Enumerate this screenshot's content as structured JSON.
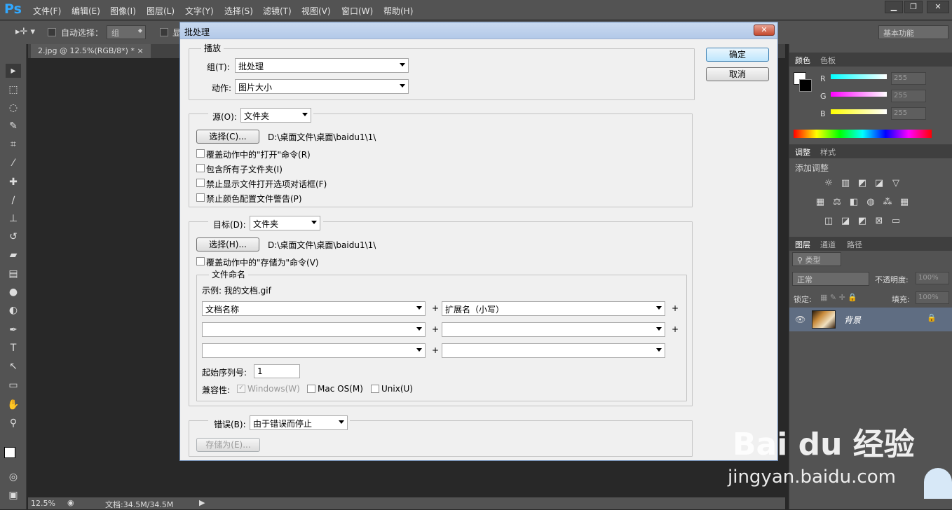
{
  "app": {
    "logo": "Ps"
  },
  "menu": [
    "文件(F)",
    "编辑(E)",
    "图像(I)",
    "图层(L)",
    "文字(Y)",
    "选择(S)",
    "滤镜(T)",
    "视图(V)",
    "窗口(W)",
    "帮助(H)"
  ],
  "options_bar": {
    "auto_select_label": "自动选择：",
    "auto_select_value": "组",
    "show_label": "显",
    "workspace": "基本功能"
  },
  "document": {
    "tab": "2.jpg @ 12.5%(RGB/8*) *",
    "close": "×"
  },
  "status": {
    "zoom": "12.5%",
    "doc": "文档:34.5M/34.5M"
  },
  "panels": {
    "color": {
      "tabs": [
        "颜色",
        "色板"
      ],
      "r": "R",
      "g": "G",
      "b": "B",
      "r_val": "255",
      "g_val": "255",
      "b_val": "255"
    },
    "adjust": {
      "tabs": [
        "调整",
        "样式"
      ],
      "title": "添加调整"
    },
    "layers": {
      "tabs": [
        "图层",
        "通道",
        "路径"
      ],
      "kind": "类型",
      "blend": "正常",
      "opacity_label": "不透明度:",
      "opacity": "100%",
      "lock_label": "锁定:",
      "fill_label": "填充:",
      "fill": "100%",
      "layer_name": "背景"
    }
  },
  "dialog": {
    "title": "批处理",
    "close": "✕",
    "ok": "确定",
    "cancel": "取消",
    "play": {
      "title": "播放",
      "group_label": "组(T):",
      "group_value": "批处理",
      "action_label": "动作:",
      "action_value": "图片大小"
    },
    "source": {
      "label": "源(O):",
      "value": "文件夹",
      "choose": "选择(C)...",
      "path": "D:\\桌面文件\\桌面\\baidu1\\1\\",
      "options": [
        "覆盖动作中的\"打开\"命令(R)",
        "包含所有子文件夹(I)",
        "禁止显示文件打开选项对话框(F)",
        "禁止颜色配置文件警告(P)"
      ]
    },
    "target": {
      "label": "目标(D):",
      "value": "文件夹",
      "choose": "选择(H)...",
      "path": "D:\\桌面文件\\桌面\\baidu1\\1\\",
      "override": "覆盖动作中的\"存储为\"命令(V)"
    },
    "naming": {
      "title": "文件命名",
      "example": "示例: 我的文档.gif",
      "f1": "文档名称",
      "f2": "扩展名（小写）",
      "plus": "+",
      "serial_label": "起始序列号:",
      "serial_value": "1",
      "compat_label": "兼容性:",
      "windows": "Windows(W)",
      "mac": "Mac OS(M)",
      "unix": "Unix(U)"
    },
    "errors": {
      "label": "错误(B):",
      "value": "由于错误而停止",
      "save": "存储为(E)..."
    }
  },
  "watermark": {
    "brand": "Bai du 经验",
    "url": "jingyan.baidu.com"
  }
}
